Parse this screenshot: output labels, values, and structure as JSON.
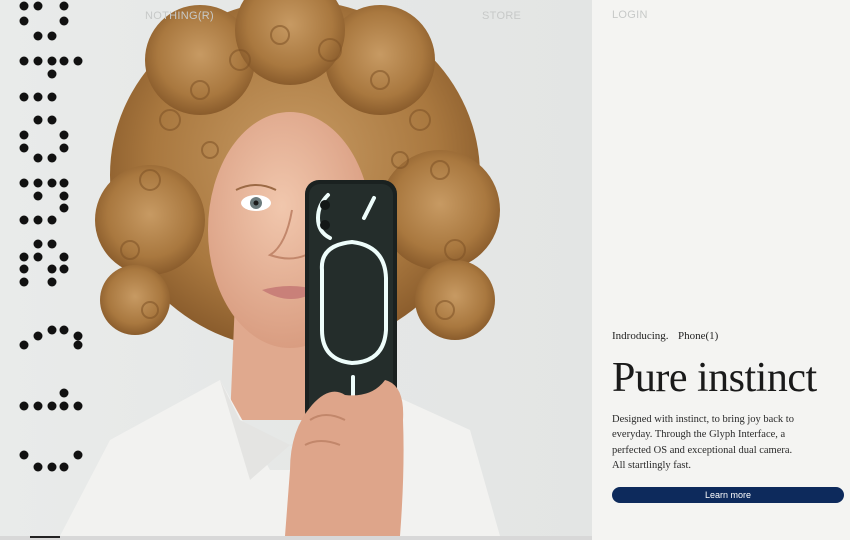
{
  "nav": {
    "brand": "NOTHING(R)",
    "store": "STORE",
    "login": "LOGIN"
  },
  "hero": {
    "image_description_icon": "phone-glyph-icon"
  },
  "content": {
    "intro_left": "Indroducing.",
    "intro_right": "Phone(1)",
    "headline": "Pure instinct",
    "description": "Designed with instinct, to bring joy back to everyday. Through the Glyph Interface, a perfected OS and exceptional dual camera. All startlingly fast.",
    "cta_label": "Learn more"
  },
  "colors": {
    "accent": "#0d2a5c",
    "panel": "#f4f4f2",
    "nav_text": "#c7c9c8"
  }
}
